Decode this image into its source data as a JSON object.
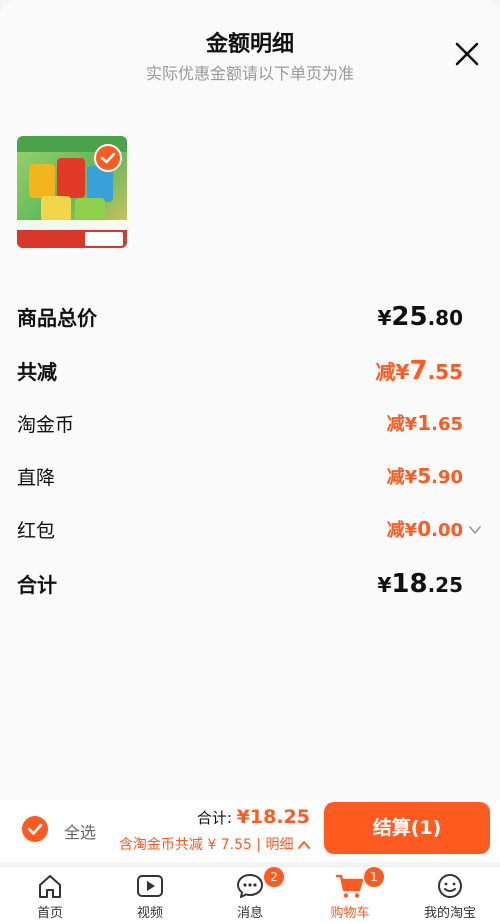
{
  "header": {
    "title": "金额明细",
    "subtitle": "实际优惠金额请以下单页为准"
  },
  "product": {
    "image_icon": "product-thumbnail",
    "selected": true
  },
  "breakdown": {
    "subtotal": {
      "label": "商品总价",
      "currency": "¥",
      "int": "25",
      "dec": ".80"
    },
    "total_discount": {
      "label": "共减",
      "prefix": "减¥",
      "int": "7",
      "dec": ".55"
    },
    "coins": {
      "label": "淘金币",
      "prefix": "减¥",
      "int": "1",
      "dec": ".65"
    },
    "direct_drop": {
      "label": "直降",
      "prefix": "减¥",
      "int": "5",
      "dec": ".90"
    },
    "red_packet": {
      "label": "红包",
      "prefix": "减¥",
      "int": "0",
      "dec": ".00"
    },
    "total": {
      "label": "合计",
      "currency": "¥",
      "int": "18",
      "dec": ".25"
    }
  },
  "checkout": {
    "select_all_label": "全选",
    "total_label": "合计: ",
    "total_currency": "¥",
    "total_int": "18",
    "total_dec": ".25",
    "discount_note": "含淘金币共减 ¥ 7.55 | 明细",
    "button_label": "结算(1)"
  },
  "tabs": [
    {
      "label": "首页",
      "icon": "home-icon"
    },
    {
      "label": "视频",
      "icon": "video-icon"
    },
    {
      "label": "消息",
      "icon": "message-icon",
      "badge": "2"
    },
    {
      "label": "购物车",
      "icon": "cart-icon",
      "badge": "1",
      "active": true
    },
    {
      "label": "我的淘宝",
      "icon": "profile-icon"
    }
  ],
  "colors": {
    "accent": "#ff5a1f",
    "text": "#111111",
    "muted": "#999999"
  }
}
